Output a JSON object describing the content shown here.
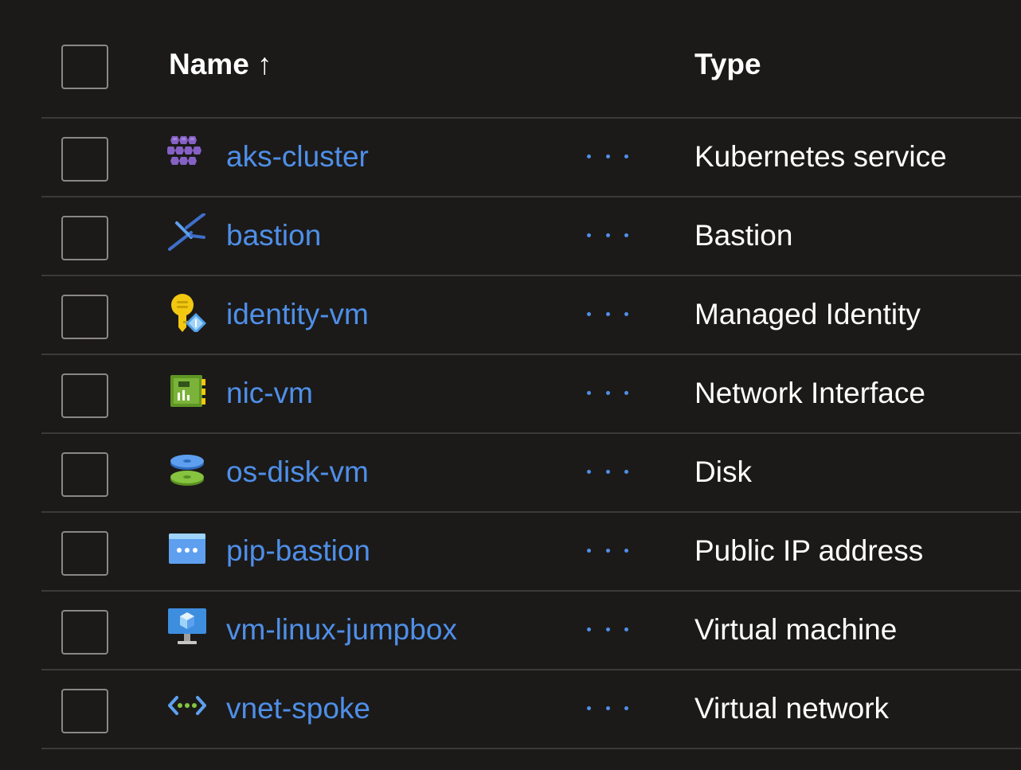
{
  "header": {
    "name_label": "Name ↑",
    "type_label": "Type"
  },
  "rows": [
    {
      "name": "aks-cluster",
      "type": "Kubernetes service",
      "icon": "kubernetes-service-icon"
    },
    {
      "name": "bastion",
      "type": "Bastion",
      "icon": "bastion-icon"
    },
    {
      "name": "identity-vm",
      "type": "Managed Identity",
      "icon": "managed-identity-icon"
    },
    {
      "name": "nic-vm",
      "type": "Network Interface",
      "icon": "network-interface-icon"
    },
    {
      "name": "os-disk-vm",
      "type": "Disk",
      "icon": "disk-icon"
    },
    {
      "name": "pip-bastion",
      "type": "Public IP address",
      "icon": "public-ip-icon"
    },
    {
      "name": "vm-linux-jumpbox",
      "type": "Virtual machine",
      "icon": "virtual-machine-icon"
    },
    {
      "name": "vnet-spoke",
      "type": "Virtual network",
      "icon": "virtual-network-icon"
    }
  ],
  "colors": {
    "background": "#1b1a19",
    "link": "#4f8fe8",
    "text": "#ffffff",
    "divider": "#3b3a39",
    "checkbox_border": "#8a8886"
  }
}
